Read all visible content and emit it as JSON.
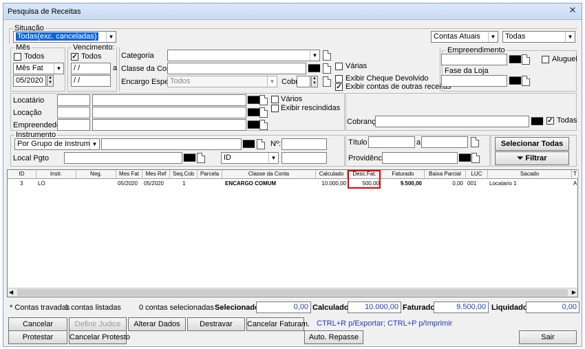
{
  "window": {
    "title": "Pesquisa de Receitas",
    "close": "✕"
  },
  "situacao": {
    "legend": "Situação",
    "value": "Todas(exc. canceladas)"
  },
  "contas": {
    "value": "Contas Atuais",
    "todas": "Todas"
  },
  "mes": {
    "legend": "Mês",
    "todos": "Todos",
    "fat": "Mês Fat",
    "value": "05/2020"
  },
  "venc": {
    "legend": "Vencimento:",
    "todos": "Todos",
    "from": "/ /",
    "a": "a",
    "to": "/ /"
  },
  "cat": {
    "label": "Categoria",
    "classe": "Classe da Conta",
    "encargo": "Encargo Espec.",
    "encargo_value": "Todos",
    "cobr": "Cobr",
    "varias": "Várias",
    "cheque": "Exibir Cheque Devolvido",
    "outras": "Exibir contas de outras receitas"
  },
  "emp": {
    "legend": "Empreendimento",
    "aluguel": "Aluguel",
    "fase": "Fase da Loja"
  },
  "partes": {
    "locatario": "Locatário",
    "locacao": "Locação",
    "empreendedor": "Empreendedor",
    "varios": "Vários",
    "rescindidas": "Exibir rescindidas"
  },
  "cobranca": {
    "label": "Cobrança",
    "todas": "Todas"
  },
  "instr": {
    "legend": "Instrumento",
    "value": "Por Grupo de Instrumento",
    "no": "Nº:",
    "local": "Local Pgto",
    "id": "ID"
  },
  "titulo": {
    "label": "Título",
    "a": "a",
    "prov": "Providência"
  },
  "actions": {
    "sel_todas": "Selecionar Todas",
    "filtrar": "Filtrar"
  },
  "grid": {
    "headers": [
      "ID",
      "Instr.",
      "Neg.",
      "Mes Fat",
      "Mes Ref",
      "Seq.Cob",
      "Parcela",
      "Classe da Conta",
      "Calculado",
      "Desc.Fat.",
      "Faturado",
      "Baixa Parcial",
      "LUC",
      "Sacado",
      "T"
    ],
    "row": {
      "id": "3",
      "instr": "LO",
      "neg": "",
      "mesfat": "05/2020",
      "mesref": "05/2020",
      "seq": "1",
      "parcela": "",
      "classe": "ENCARGO COMUM",
      "calc": "10.000,00",
      "desc": "500,00",
      "fat": "9.500,00",
      "baixa": "0,00",
      "luc": "001",
      "sacado": "Locatario 1",
      "t": "A"
    }
  },
  "summary": {
    "travadas": "* Contas travadas",
    "listadas": "1 contas listadas",
    "selecionadas": "0 contas selecionadas",
    "sel_label": "Selecionado",
    "sel_value": "0,00",
    "calc_label": "Calculado",
    "calc_value": "10.000,00",
    "fat_label": "Faturado",
    "fat_value": "9.500,00",
    "liq_label": "Liquidado",
    "liq_value": "0,00"
  },
  "buttons": {
    "cancelar": "Cancelar",
    "judice": "Definir Judice",
    "alterar": "Alterar Dados",
    "destravar": "Destravar",
    "cancfat": "Cancelar Faturam.",
    "protestar": "Protestar",
    "cancprot": "Cancelar Protesto",
    "repasse": "Auto. Repasse",
    "sair": "Sair",
    "shortcut": "CTRL+R p/Exportar; CTRL+P p/Imprimir"
  },
  "colors": {
    "highlight": "#e00000",
    "selection": "#0a64d8"
  }
}
